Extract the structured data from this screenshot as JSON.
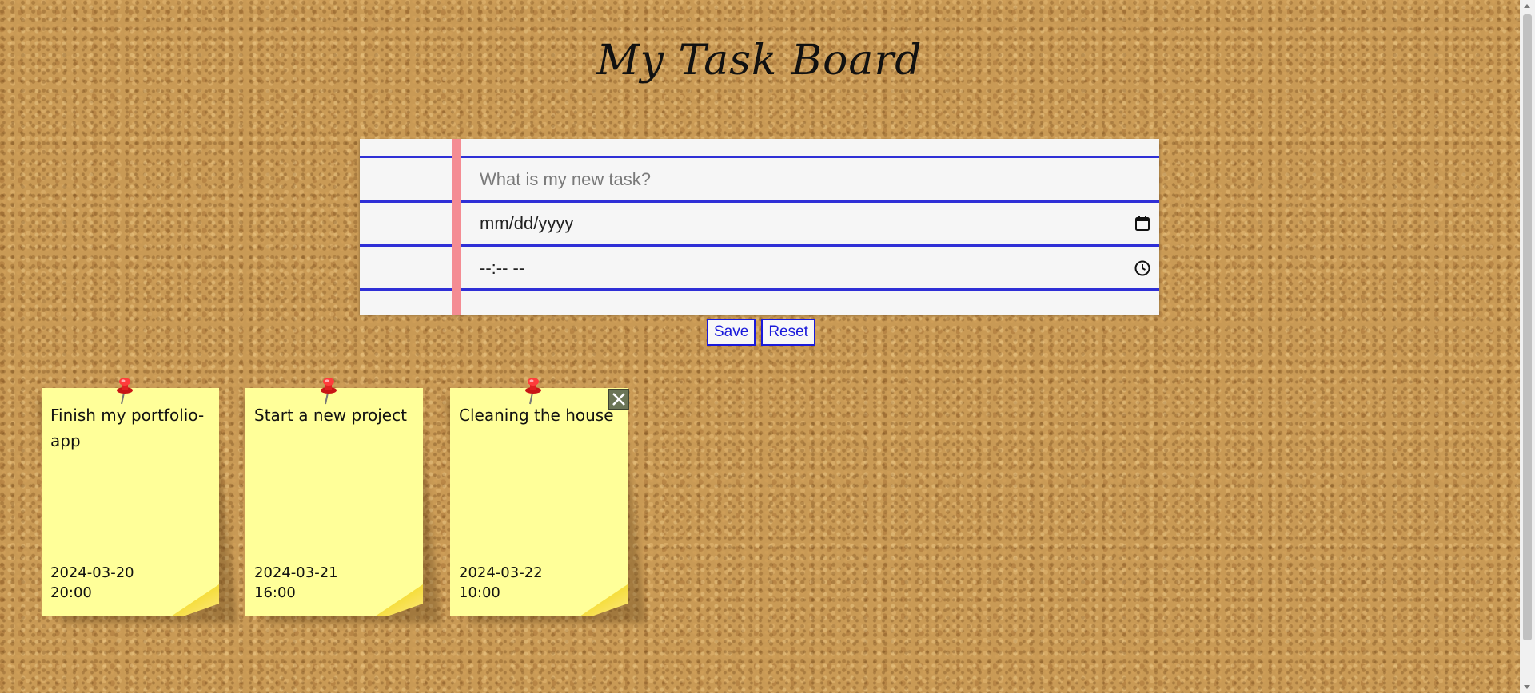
{
  "header": {
    "title": "My Task Board"
  },
  "form": {
    "task_placeholder": "What is my new task?",
    "date_value": "mm/dd/yyyy",
    "time_value": "--:-- --",
    "save_label": "Save",
    "reset_label": "Reset"
  },
  "notes": [
    {
      "title": "Finish my portfolio-app",
      "date": "2024-03-20",
      "time": "20:00"
    },
    {
      "title": "Start a new project",
      "date": "2024-03-21",
      "time": "16:00"
    },
    {
      "title": "Cleaning the house",
      "date": "2024-03-22",
      "time": "10:00"
    }
  ],
  "icons": {
    "date_field": "calendar-icon",
    "time_field": "clock-icon",
    "note_pin": "pushpin-icon",
    "note_delete": "close-icon"
  },
  "colors": {
    "paper_rule": "#2f2fd6",
    "paper_margin": "#f48c93",
    "note_fill": "#ffff99",
    "button_accent": "#1a1adb",
    "pin_red": "#e02020",
    "close_button": "#6b7556"
  }
}
